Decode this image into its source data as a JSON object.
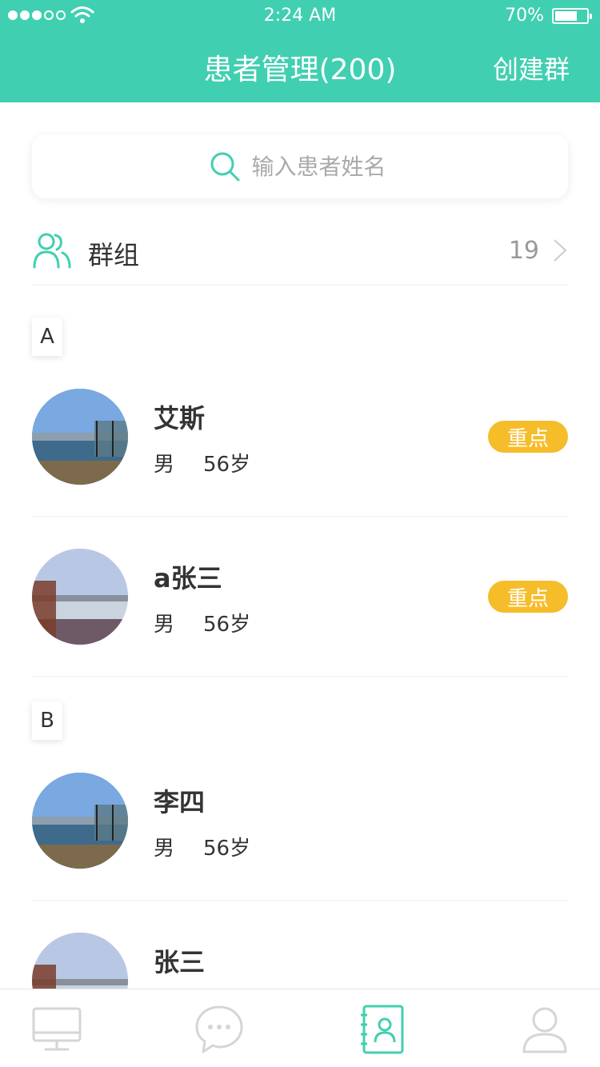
{
  "status_bar": {
    "time": "2:24 AM",
    "battery_percent": "70%",
    "battery_level": 0.7,
    "signal_bars": 5,
    "signal_filled": 3
  },
  "header": {
    "title": "患者管理(200)",
    "create_group_label": "创建群"
  },
  "search": {
    "placeholder": "输入患者姓名",
    "icon": "search-icon"
  },
  "groups": {
    "label": "群组",
    "count": "19",
    "icon": "group-users-icon"
  },
  "sections": [
    {
      "letter": "A",
      "patients": [
        {
          "name": "艾斯",
          "gender": "男",
          "age": "56岁",
          "badge": "重点"
        },
        {
          "name": "a张三",
          "gender": "男",
          "age": "56岁",
          "badge": "重点"
        }
      ]
    },
    {
      "letter": "B",
      "patients": [
        {
          "name": "李四",
          "gender": "男",
          "age": "56岁",
          "badge": ""
        },
        {
          "name": "张三",
          "gender": "",
          "age": "",
          "badge": ""
        }
      ]
    }
  ],
  "colors": {
    "primary": "#41cfb1",
    "badge": "#f6bd2a",
    "tab_inactive": "#d5d5d5"
  },
  "tabbar": {
    "items": [
      {
        "icon": "monitor-icon",
        "active": false
      },
      {
        "icon": "chat-bubble-icon",
        "active": false
      },
      {
        "icon": "contacts-book-icon",
        "active": true
      },
      {
        "icon": "user-profile-icon",
        "active": false
      }
    ]
  }
}
